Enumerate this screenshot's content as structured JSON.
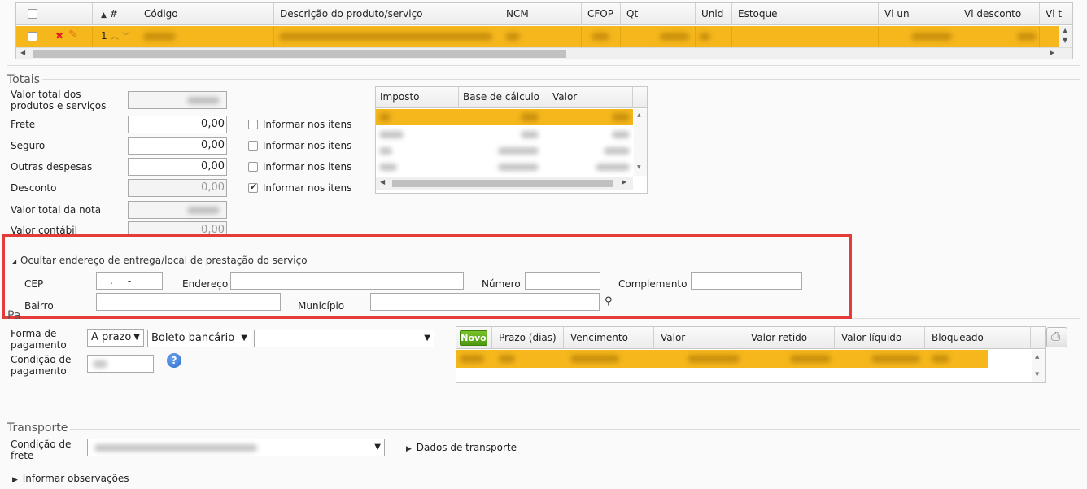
{
  "items_grid": {
    "columns": [
      "#",
      "Código",
      "Descrição do produto/serviço",
      "NCM",
      "CFOP",
      "Qt",
      "Unid",
      "Estoque",
      "Vl un",
      "Vl desconto",
      "Vl t"
    ],
    "row": {
      "index": "1"
    }
  },
  "totais": {
    "title": "Totais",
    "valor_total_label": "Valor total dos produtos e serviços",
    "frete_label": "Frete",
    "frete_value": "0,00",
    "seguro_label": "Seguro",
    "seguro_value": "0,00",
    "outras_label": "Outras despesas",
    "outras_value": "0,00",
    "desconto_label": "Desconto",
    "desconto_value": "0,00",
    "valor_total_nota_label": "Valor total da nota",
    "valor_contabil_label": "Valor contábil",
    "valor_contabil_value": "0,00",
    "informar_itens_label": "Informar nos itens",
    "informar_checked": [
      false,
      false,
      false,
      true
    ]
  },
  "tax_grid": {
    "columns": [
      "Imposto",
      "Base de cálculo",
      "Valor"
    ]
  },
  "endereco": {
    "toggle_label": "Ocultar endereço de entrega/local de prestação do serviço",
    "cep_label": "CEP",
    "cep_placeholder": "__.___-___",
    "endereco_label": "Endereço",
    "numero_label": "Número",
    "complemento_label": "Complemento",
    "bairro_label": "Bairro",
    "municipio_label": "Município"
  },
  "pagamento": {
    "section_fragment": "Pa",
    "forma_label": "Forma de pagamento",
    "forma_value": "A prazo",
    "tipo_value": "Boleto bancário",
    "condicao_label": "Condição de pagamento",
    "grid_new_button": "Novo",
    "grid_columns": [
      "Prazo (dias)",
      "Vencimento",
      "Valor",
      "Valor retido",
      "Valor líquido",
      "Bloqueado"
    ]
  },
  "transporte": {
    "title": "Transporte",
    "condicao_frete_label": "Condição de frete",
    "dados_label": "Dados de transporte"
  },
  "observacoes": {
    "label": "Informar observações"
  },
  "colors": {
    "selected_row": "#f5b71c",
    "highlight_border": "#e63b3b",
    "novo_green": "#5fa81a",
    "help_blue": "#2f6fcf"
  }
}
